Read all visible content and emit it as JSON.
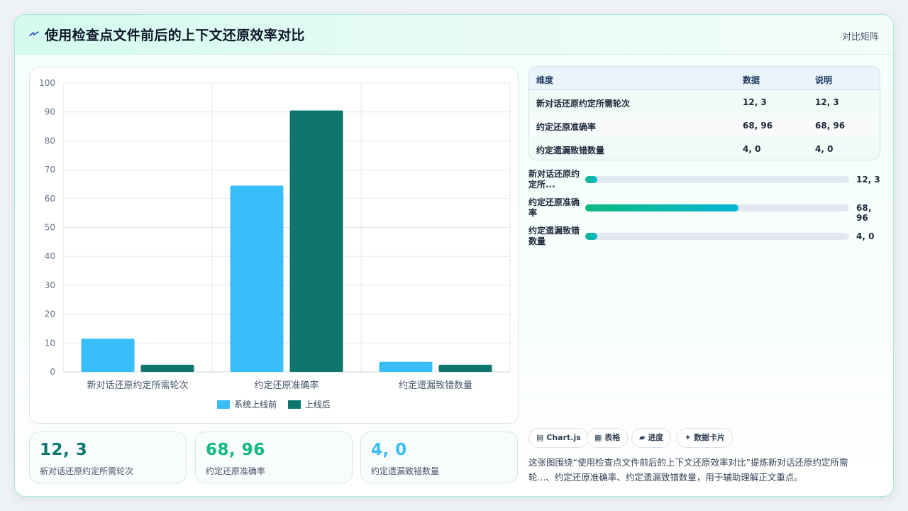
{
  "header": {
    "title": "使用检查点文件前后的上下文还原效率对比",
    "tag": "对比矩阵"
  },
  "colors": {
    "before": "#38bdf8",
    "after": "#0f766e",
    "accent": "#10b981",
    "kpi_values": [
      "#0f766e",
      "#10b981",
      "#38bdf8"
    ]
  },
  "chart_data": {
    "type": "bar",
    "categories": [
      "新对话还原约定所需轮次",
      "约定还原准确率",
      "约定遗漏致错数量"
    ],
    "series": [
      {
        "name": "系统上线前",
        "values": [
          11.5,
          64.5,
          3.5
        ]
      },
      {
        "name": "上线后",
        "values": [
          2.5,
          90.5,
          2.5
        ]
      }
    ],
    "ylim": [
      0,
      100
    ],
    "yticks": [
      0,
      10,
      20,
      30,
      40,
      50,
      60,
      70,
      80,
      90,
      100
    ],
    "grid": true,
    "legend": "bottom"
  },
  "table": {
    "headers": [
      "维度",
      "数据",
      "说明"
    ],
    "rows": [
      [
        "新对话还原约定所需轮次",
        "12, 3",
        "12, 3"
      ],
      [
        "约定还原准确率",
        "68, 96",
        "68, 96"
      ],
      [
        "约定遗漏致错数量",
        "4, 0",
        "4, 0"
      ]
    ]
  },
  "bars": [
    {
      "label": "新对话还原约定所...",
      "value": "12, 3",
      "fraction": 0.045
    },
    {
      "label": "约定还原准确率",
      "value": "68, 96",
      "fraction": 0.58
    },
    {
      "label": "约定遗漏致错数量",
      "value": "4, 0",
      "fraction": 0.045
    }
  ],
  "kpis": [
    {
      "value": "12, 3",
      "label": "新对话还原约定所需轮次"
    },
    {
      "value": "68, 96",
      "label": "约定还原准确率"
    },
    {
      "value": "4, 0",
      "label": "约定遗漏致错数量"
    }
  ],
  "chips": [
    {
      "icon": "▤",
      "label": "Chart.js"
    },
    {
      "icon": "▦",
      "label": "表格"
    },
    {
      "icon": "▰",
      "label": "进度"
    },
    {
      "icon": "✦",
      "label": "数据卡片"
    }
  ],
  "summary": "这张图围绕“使用检查点文件前后的上下文还原效率对比”提炼新对话还原约定所需轮...、约定还原准确率、约定遗漏致错数量，用于辅助理解正文重点。"
}
